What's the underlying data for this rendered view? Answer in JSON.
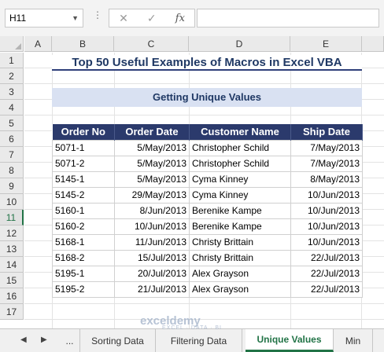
{
  "formula_bar": {
    "name_box": "H11",
    "fx_label": "fx"
  },
  "columns": [
    "A",
    "B",
    "C",
    "D",
    "E"
  ],
  "rows": [
    "1",
    "2",
    "3",
    "4",
    "5",
    "6",
    "7",
    "8",
    "9",
    "10",
    "11",
    "12",
    "13",
    "14",
    "15",
    "16",
    "17"
  ],
  "active_row": "11",
  "title": "Top 50 Useful Examples of Macros in Excel VBA",
  "subtitle": "Getting Unique Values",
  "table": {
    "headers": [
      "Order No",
      "Order Date",
      "Customer Name",
      "Ship Date"
    ],
    "rows": [
      [
        "5071-1",
        "5/May/2013",
        "Christopher Schild",
        "7/May/2013"
      ],
      [
        "5071-2",
        "5/May/2013",
        "Christopher Schild",
        "7/May/2013"
      ],
      [
        "5145-1",
        "5/May/2013",
        "Cyma Kinney",
        "8/May/2013"
      ],
      [
        "5145-2",
        "29/May/2013",
        "Cyma Kinney",
        "10/Jun/2013"
      ],
      [
        "5160-1",
        "8/Jun/2013",
        "Berenike Kampe",
        "10/Jun/2013"
      ],
      [
        "5160-2",
        "10/Jun/2013",
        "Berenike Kampe",
        "10/Jun/2013"
      ],
      [
        "5168-1",
        "11/Jun/2013",
        "Christy Brittain",
        "10/Jun/2013"
      ],
      [
        "5168-2",
        "15/Jul/2013",
        "Christy Brittain",
        "22/Jul/2013"
      ],
      [
        "5195-1",
        "20/Jul/2013",
        "Alex Grayson",
        "22/Jul/2013"
      ],
      [
        "5195-2",
        "21/Jul/2013",
        "Alex Grayson",
        "22/Jul/2013"
      ]
    ]
  },
  "tabs": {
    "ellipsis": "...",
    "items": [
      "Sorting Data",
      "Filtering Data",
      "Unique Values",
      "Min"
    ],
    "active": "Unique Values"
  },
  "watermark": {
    "name": "exceldemy",
    "tagline": "EXCEL · DATA · BI"
  },
  "colors": {
    "header_fill": "#2b3a6c",
    "subtitle_fill": "#d9e1f2",
    "title_text": "#1f3864",
    "accent": "#217346"
  }
}
